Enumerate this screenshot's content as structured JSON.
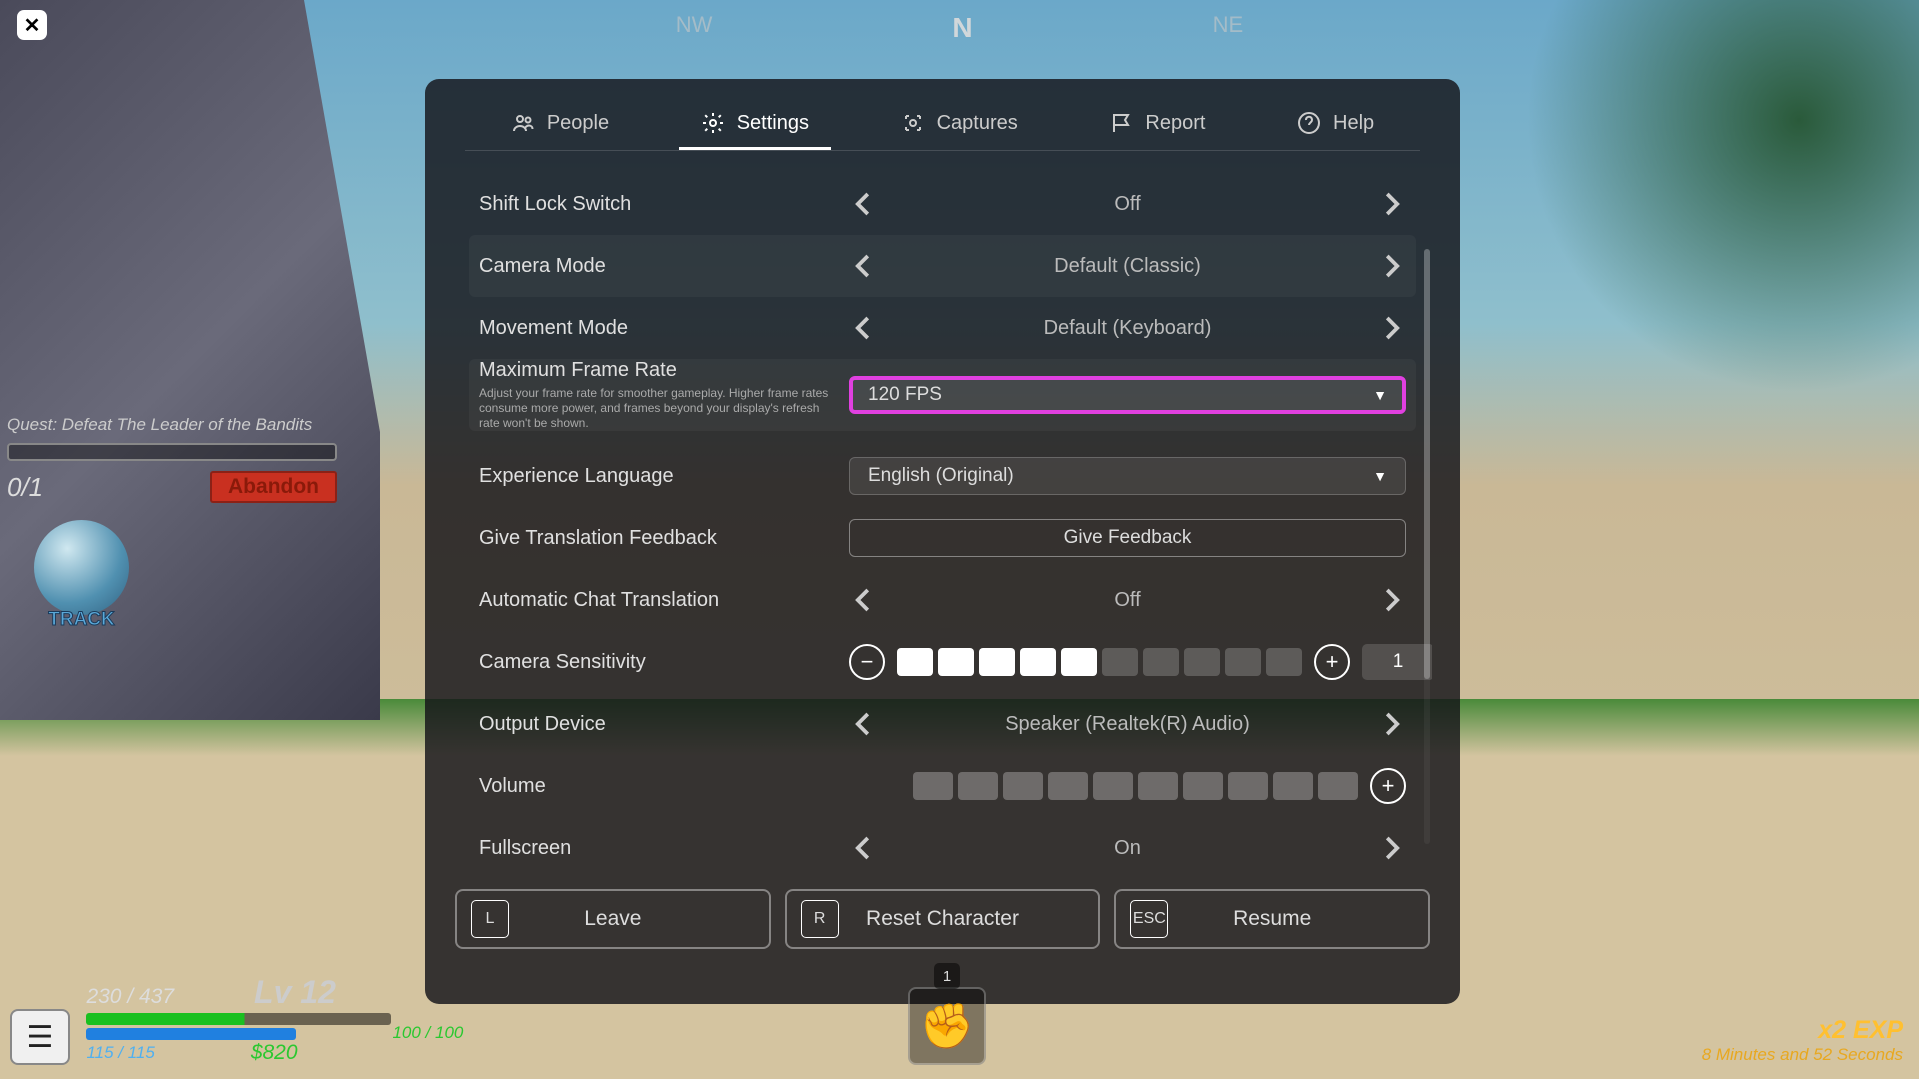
{
  "compass": {
    "nw": "NW",
    "n": "N",
    "ne": "NE"
  },
  "quest": {
    "title": "Quest: Defeat The Leader of the Bandits",
    "progress": "0/1",
    "abandon": "Abandon",
    "track_label": "TRACK"
  },
  "tabs": {
    "people": "People",
    "settings": "Settings",
    "captures": "Captures",
    "report": "Report",
    "help": "Help"
  },
  "settings": {
    "shift_lock": {
      "label": "Shift Lock Switch",
      "value": "Off"
    },
    "camera_mode": {
      "label": "Camera Mode",
      "value": "Default (Classic)"
    },
    "movement_mode": {
      "label": "Movement Mode",
      "value": "Default (Keyboard)"
    },
    "max_fps": {
      "label": "Maximum Frame Rate",
      "desc": "Adjust your frame rate for smoother gameplay. Higher frame rates consume more power, and frames beyond your display's refresh rate won't be shown.",
      "value": "120 FPS"
    },
    "exp_lang": {
      "label": "Experience Language",
      "value": "English (Original)"
    },
    "trans_feedback": {
      "label": "Give Translation Feedback",
      "button": "Give Feedback"
    },
    "auto_chat_trans": {
      "label": "Automatic Chat Translation",
      "value": "Off"
    },
    "cam_sens": {
      "label": "Camera Sensitivity",
      "value": "1",
      "filled": 5,
      "total": 10
    },
    "output_device": {
      "label": "Output Device",
      "value": "Speaker (Realtek(R) Audio)"
    },
    "volume": {
      "label": "Volume",
      "total": 10
    },
    "fullscreen": {
      "label": "Fullscreen",
      "value": "On"
    }
  },
  "footer": {
    "leave_key": "L",
    "leave": "Leave",
    "reset_key": "R",
    "reset": "Reset Character",
    "resume_key": "ESC",
    "resume": "Resume"
  },
  "hud": {
    "hp": "230 / 437",
    "level": "Lv 12",
    "stamina": "100 / 100",
    "bp": "115 / 115",
    "money": "$820",
    "hotbar_num": "1"
  },
  "exp_boost": {
    "title": "x2 EXP",
    "time": "8 Minutes and 52 Seconds"
  }
}
